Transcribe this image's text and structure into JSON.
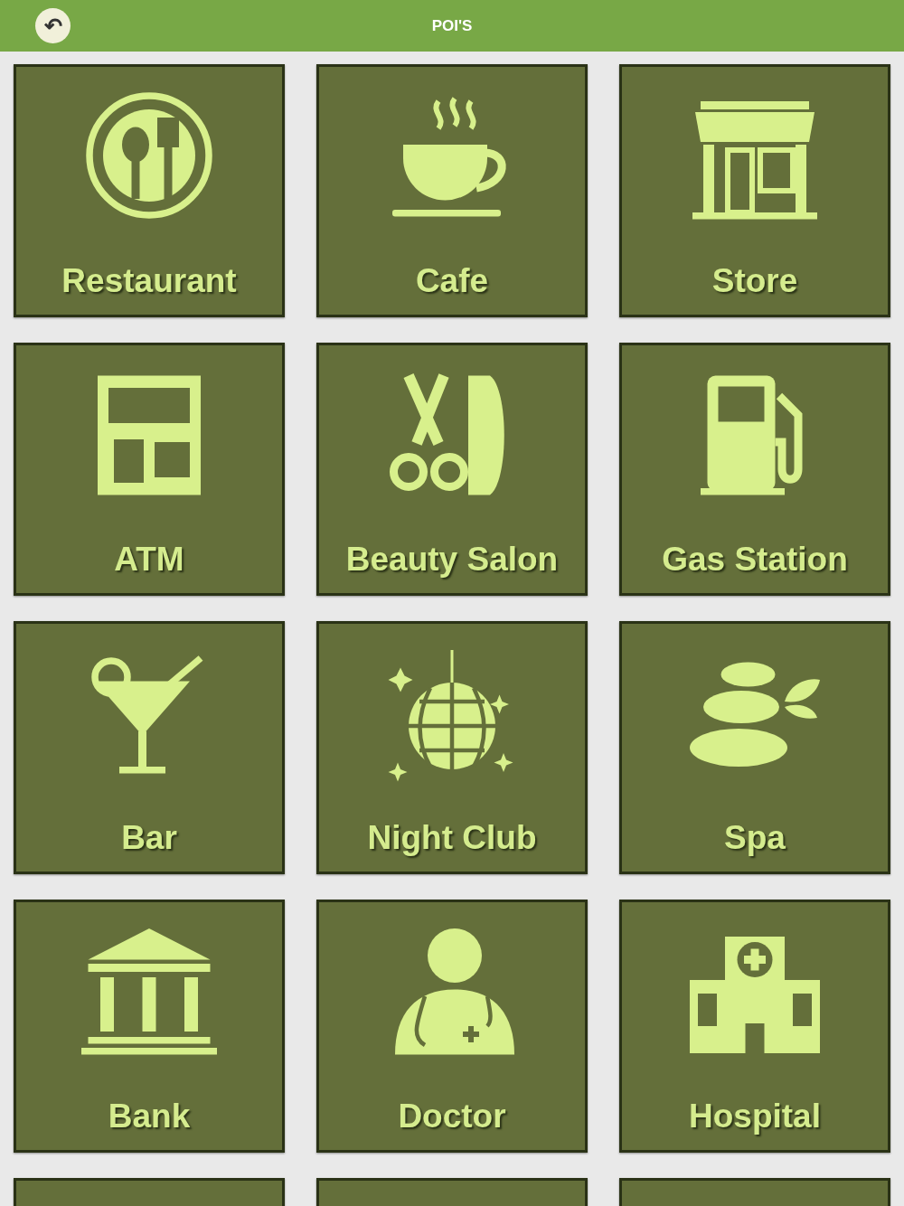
{
  "header": {
    "title": "POI'S",
    "back_button": "↶"
  },
  "tiles": [
    {
      "kind": "poi",
      "label": "Restaurant"
    },
    {
      "kind": "poi",
      "label": "Cafe"
    },
    {
      "kind": "poi",
      "label": "Store"
    },
    {
      "kind": "poi",
      "label": "ATM"
    },
    {
      "kind": "poi",
      "label": "Beauty Salon"
    },
    {
      "kind": "poi",
      "label": "Gas Station"
    },
    {
      "kind": "poi",
      "label": "Bar"
    },
    {
      "kind": "poi",
      "label": "Night Club"
    },
    {
      "kind": "poi",
      "label": "Spa"
    },
    {
      "kind": "poi",
      "label": "Bank"
    },
    {
      "kind": "poi",
      "label": "Doctor"
    },
    {
      "kind": "poi",
      "label": "Hospital"
    },
    {
      "kind": "cut"
    },
    {
      "kind": "cut"
    },
    {
      "kind": "cut"
    }
  ]
}
